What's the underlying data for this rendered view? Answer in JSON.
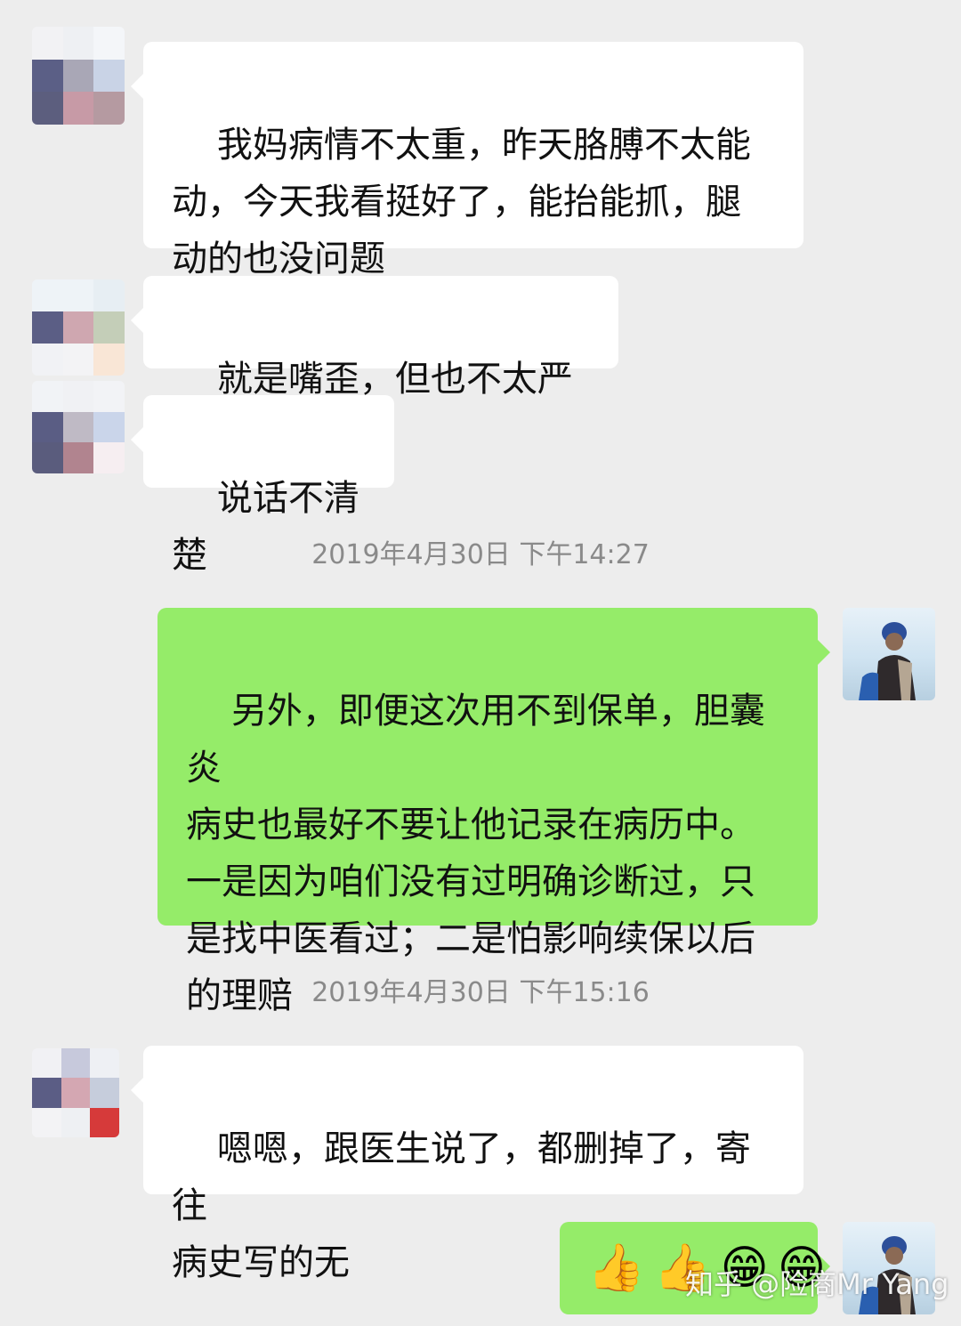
{
  "messages": [
    {
      "side": "in",
      "text": "我妈病情不太重，昨天胳膊不太能\n动，今天我看挺好了，能抬能抓，腿\n动的也没问题"
    },
    {
      "side": "in",
      "text": "就是嘴歪，但也不太严重"
    },
    {
      "side": "in",
      "text": "说话不清楚"
    },
    {
      "side": "out",
      "text": "另外，即便这次用不到保单，胆囊炎\n病史也最好不要让他记录在病历中。\n一是因为咱们没有过明确诊断过，只\n是找中医看过；二是怕影响续保以后\n的理赔"
    },
    {
      "side": "in",
      "text": "嗯嗯，跟医生说了，都删掉了，寄往\n病史写的无"
    }
  ],
  "timestamps": [
    "2019年4月30日 下午14:27",
    "2019年4月30日 下午15:16"
  ],
  "last_message_emojis": [
    "👍",
    "👍",
    "😁",
    "😁"
  ],
  "watermark": "知乎 @险商Mr Yang",
  "colors": {
    "background": "#ededed",
    "incoming_bubble": "#ffffff",
    "outgoing_bubble": "#95ec69",
    "timestamp_text": "#8a8a8a"
  }
}
